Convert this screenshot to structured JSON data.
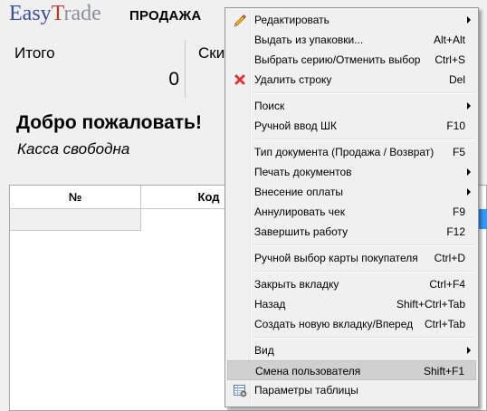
{
  "app": {
    "logo": {
      "part1": "Easy",
      "part2": "T",
      "part3": "rade"
    },
    "mode": "ПРОДАЖА"
  },
  "totals": {
    "total_label": "Итого",
    "total_value": "0",
    "discount_label": "Скидка"
  },
  "welcome": "Добро пожаловать!",
  "status": "Касса свободна",
  "table": {
    "columns": [
      "№",
      "Код"
    ]
  },
  "menu": {
    "items": [
      {
        "label": "Редактировать",
        "shortcut": "",
        "submenu": true,
        "icon": "pencil-icon"
      },
      {
        "label": "Выдать из упаковки...",
        "shortcut": "Alt+Alt"
      },
      {
        "label": "Выбрать серию/Отменить выбор",
        "shortcut": "Ctrl+S"
      },
      {
        "label": "Удалить строку",
        "shortcut": "Del",
        "icon": "delete-x-icon"
      },
      {
        "label": "Поиск",
        "shortcut": "",
        "submenu": true
      },
      {
        "label": "Ручной ввод ШК",
        "shortcut": "F10"
      },
      {
        "label": "Тип документа (Продажа / Возврат)",
        "shortcut": "F5"
      },
      {
        "label": "Печать документов",
        "shortcut": "",
        "submenu": true
      },
      {
        "label": "Внесение оплаты",
        "shortcut": "",
        "submenu": true
      },
      {
        "label": "Аннулировать чек",
        "shortcut": "F9"
      },
      {
        "label": "Завершить работу",
        "shortcut": "F12"
      },
      {
        "label": "Ручной выбор карты покупателя",
        "shortcut": "Ctrl+D"
      },
      {
        "label": "Закрыть вкладку",
        "shortcut": "Ctrl+F4"
      },
      {
        "label": "Назад",
        "shortcut": "Shift+Ctrl+Tab"
      },
      {
        "label": "Создать новую вкладку/Вперед",
        "shortcut": "Ctrl+Tab"
      },
      {
        "label": "Вид",
        "shortcut": "",
        "submenu": true
      },
      {
        "label": "Смена пользователя",
        "shortcut": "Shift+F1",
        "highlighted": true
      },
      {
        "label": "Параметры таблицы",
        "shortcut": "",
        "icon": "table-settings-icon"
      }
    ]
  },
  "colors": {
    "highlight": "#d0d0d0",
    "selection": "#3399ff",
    "delete_icon": "#d93636",
    "logo_blue": "#3a4fa0",
    "logo_red": "#c0392b"
  }
}
